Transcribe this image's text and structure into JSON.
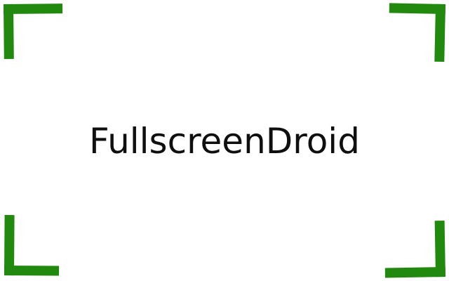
{
  "title": "FullscreenDroid",
  "icons": {
    "corner_top_left": "corner-bracket-top-left-icon",
    "corner_top_right": "corner-bracket-top-right-icon",
    "corner_bottom_left": "corner-bracket-bottom-left-icon",
    "corner_bottom_right": "corner-bracket-bottom-right-icon"
  },
  "colors": {
    "accent": "#218a0e",
    "background": "#ffffff",
    "text": "#0f0f0f"
  }
}
